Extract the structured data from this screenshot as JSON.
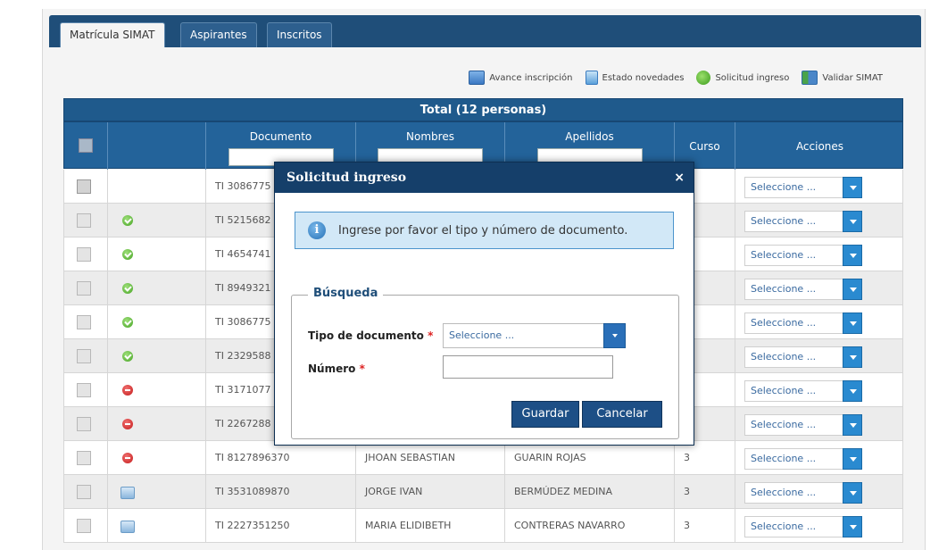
{
  "tabs": [
    {
      "label": "Matrícula SIMAT",
      "active": true
    },
    {
      "label": "Aspirantes",
      "active": false
    },
    {
      "label": "Inscritos",
      "active": false
    }
  ],
  "toolbar": {
    "avance": "Avance inscripción",
    "estado": "Estado novedades",
    "solicitud": "Solicitud ingreso",
    "validar": "Validar SIMAT"
  },
  "grid": {
    "title": "Total (12 personas)",
    "headers": {
      "documento": "Documento",
      "nombres": "Nombres",
      "apellidos": "Apellidos",
      "curso": "Curso",
      "acciones": "Acciones"
    },
    "select_placeholder": "Seleccione ...",
    "rows": [
      {
        "status": "none",
        "doc": "TI 3086775",
        "nombres": "",
        "apellidos": "",
        "curso": ""
      },
      {
        "status": "ok",
        "doc": "TI 5215682",
        "nombres": "",
        "apellidos": "",
        "curso": ""
      },
      {
        "status": "ok",
        "doc": "TI 4654741",
        "nombres": "",
        "apellidos": "",
        "curso": ""
      },
      {
        "status": "ok",
        "doc": "TI 8949321",
        "nombres": "",
        "apellidos": "",
        "curso": ""
      },
      {
        "status": "ok",
        "doc": "TI 3086775",
        "nombres": "",
        "apellidos": "",
        "curso": ""
      },
      {
        "status": "ok",
        "doc": "TI 2329588",
        "nombres": "",
        "apellidos": "",
        "curso": ""
      },
      {
        "status": "no",
        "doc": "TI 3171077",
        "nombres": "",
        "apellidos": "",
        "curso": ""
      },
      {
        "status": "no",
        "doc": "TI 2267288",
        "nombres": "",
        "apellidos": "",
        "curso": ""
      },
      {
        "status": "no",
        "doc": "TI 8127896370",
        "nombres": "JHOAN SEBASTIAN",
        "apellidos": "GUARIN ROJAS",
        "curso": "3"
      },
      {
        "status": "pend",
        "doc": "TI 3531089870",
        "nombres": "JORGE IVAN",
        "apellidos": "BERMÚDEZ MEDINA",
        "curso": "3"
      },
      {
        "status": "pend",
        "doc": "TI 2227351250",
        "nombres": "MARIA ELIDIBETH",
        "apellidos": "CONTRERAS NAVARRO",
        "curso": "3"
      }
    ]
  },
  "modal": {
    "title": "Solicitud ingreso",
    "close": "×",
    "info": "Ingrese por favor el tipo y número de documento.",
    "info_icon": "i",
    "legend": "Búsqueda",
    "tipo_label": "Tipo de documento",
    "numero_label": "Número",
    "required_mark": "*",
    "tipo_value": "Seleccione ...",
    "numero_value": "",
    "save": "Guardar",
    "cancel": "Cancelar"
  }
}
